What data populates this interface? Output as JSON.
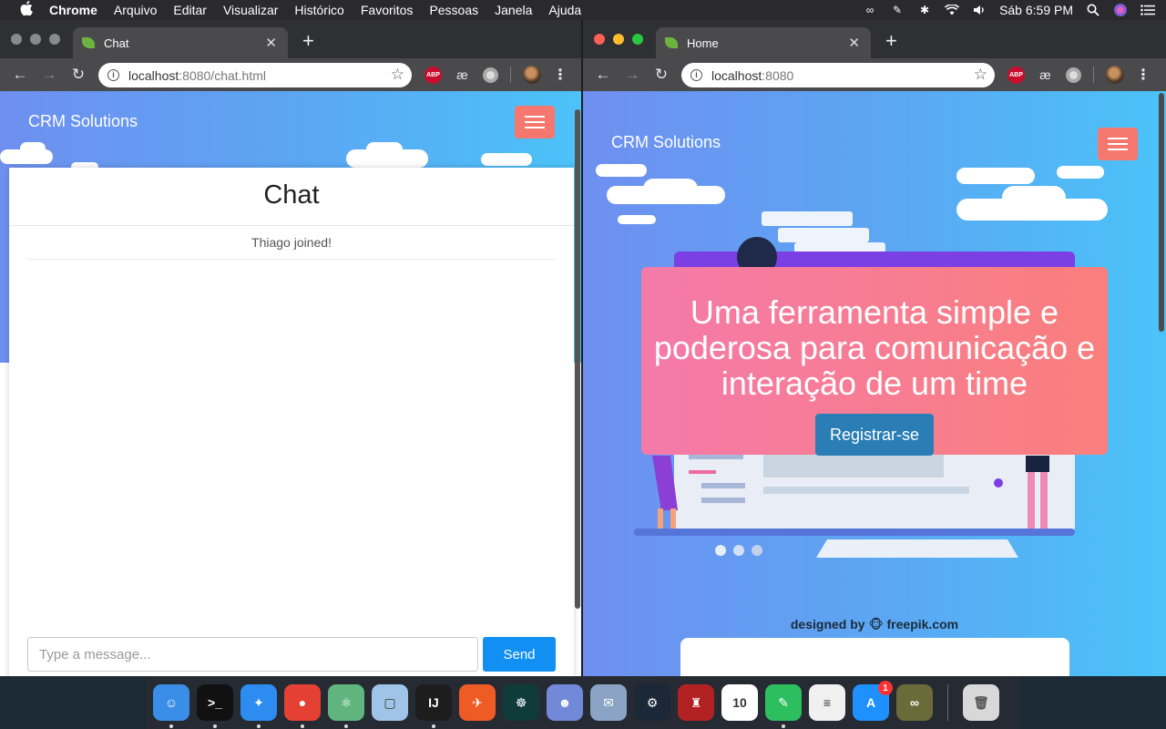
{
  "menubar": {
    "app": "Chrome",
    "items": [
      "Arquivo",
      "Editar",
      "Visualizar",
      "Histórico",
      "Favoritos",
      "Pessoas",
      "Janela",
      "Ajuda"
    ],
    "clock": "Sáb 6:59 PM"
  },
  "left_window": {
    "tab_title": "Chat",
    "url_host": "localhost",
    "url_rest": ":8080/chat.html",
    "brand": "CRM Solutions",
    "chat_title": "Chat",
    "messages": [
      "Thiago joined!"
    ],
    "input_placeholder": "Type a message...",
    "send_label": "Send"
  },
  "right_window": {
    "tab_title": "Home",
    "url_host": "localhost",
    "url_rest": ":8080",
    "brand": "CRM Solutions",
    "headline": "Uma ferramenta simple e poderosa para comunicação e interação de um time",
    "cta_label": "Registrar-se",
    "credit": "designed by 🐵 freepik.com"
  },
  "extensions": {
    "abp_label": "ABP",
    "ae_label": "æ"
  },
  "dock": {
    "items": [
      {
        "name": "finder-icon",
        "color": "#3b8ee8",
        "glyph": "☺"
      },
      {
        "name": "terminal-icon",
        "color": "#111111",
        "glyph": ">_"
      },
      {
        "name": "safari-icon",
        "color": "#2d8cf0",
        "glyph": "✦"
      },
      {
        "name": "chrome-icon",
        "color": "#e44134",
        "glyph": "●"
      },
      {
        "name": "atom-icon",
        "color": "#5fb57d",
        "glyph": "⚛"
      },
      {
        "name": "virtualbox-icon",
        "color": "#9fc4e8",
        "glyph": "▢"
      },
      {
        "name": "intellij-icon",
        "color": "#1d1d1d",
        "glyph": "IJ"
      },
      {
        "name": "postman-icon",
        "color": "#ef5b25",
        "glyph": "✈"
      },
      {
        "name": "gitkraken-icon",
        "color": "#0f3c3a",
        "glyph": "☸"
      },
      {
        "name": "discord-icon",
        "color": "#7289da",
        "glyph": "☻"
      },
      {
        "name": "preview-icon",
        "color": "#8ba3c4",
        "glyph": "✉"
      },
      {
        "name": "steam-icon",
        "color": "#1b2838",
        "glyph": "⚙"
      },
      {
        "name": "joystick-icon",
        "color": "#b22222",
        "glyph": "♜"
      },
      {
        "name": "calendar-icon",
        "color": "#ffffff",
        "glyph": "10"
      },
      {
        "name": "evernote-icon",
        "color": "#2dbe60",
        "glyph": "✎"
      },
      {
        "name": "textedit-icon",
        "color": "#f0f0f0",
        "glyph": "≡"
      },
      {
        "name": "appstore-icon",
        "color": "#1e90ff",
        "glyph": "A",
        "badge": "1"
      },
      {
        "name": "glasses-icon",
        "color": "#6b6b3a",
        "glyph": "∞"
      }
    ],
    "trash_glyph": "🗑"
  }
}
